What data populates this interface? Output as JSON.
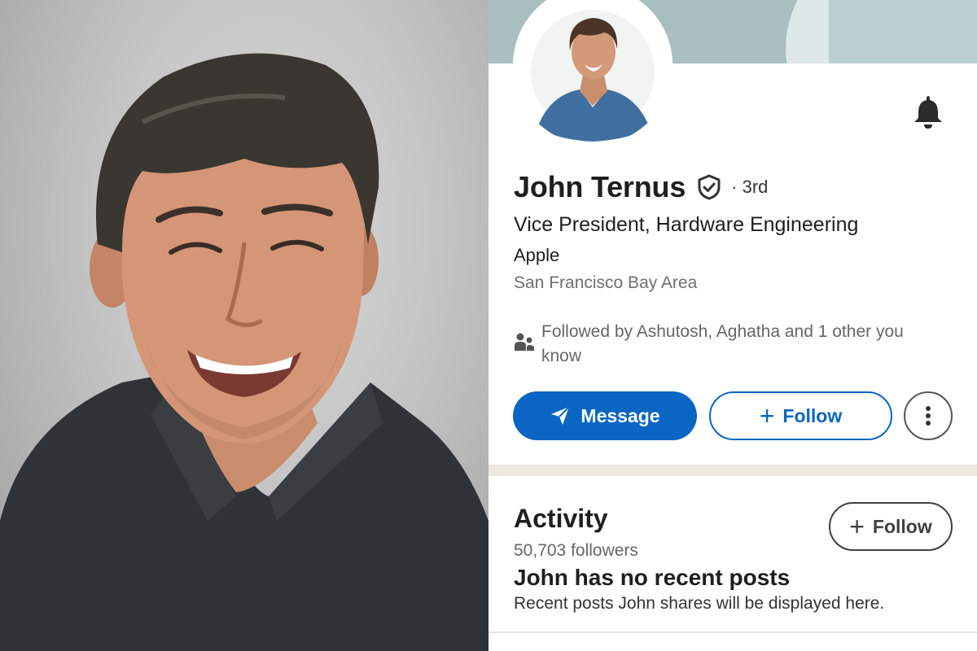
{
  "profile": {
    "name": "John Ternus",
    "degree": "· 3rd",
    "headline": "Vice President, Hardware Engineering",
    "company": "Apple",
    "location": "San Francisco Bay Area",
    "mutual_connections": "Followed by Ashutosh, Aghatha and 1 other you know"
  },
  "actions": {
    "message_label": "Message",
    "follow_label": "Follow",
    "more_icon": "more-vertical-icon"
  },
  "activity": {
    "title": "Activity",
    "followers": "50,703 followers",
    "follow_label": "Follow",
    "empty_title": "John has no recent posts",
    "empty_desc": "Recent posts John shares will be displayed here."
  },
  "icons": {
    "bell": "bell-icon",
    "verified": "verified-shield-icon",
    "people": "people-icon",
    "send": "send-icon",
    "plus": "plus-icon"
  },
  "colors": {
    "brand_blue": "#0a66c2",
    "banner": "#b8cccd",
    "divider": "#ece7df"
  }
}
